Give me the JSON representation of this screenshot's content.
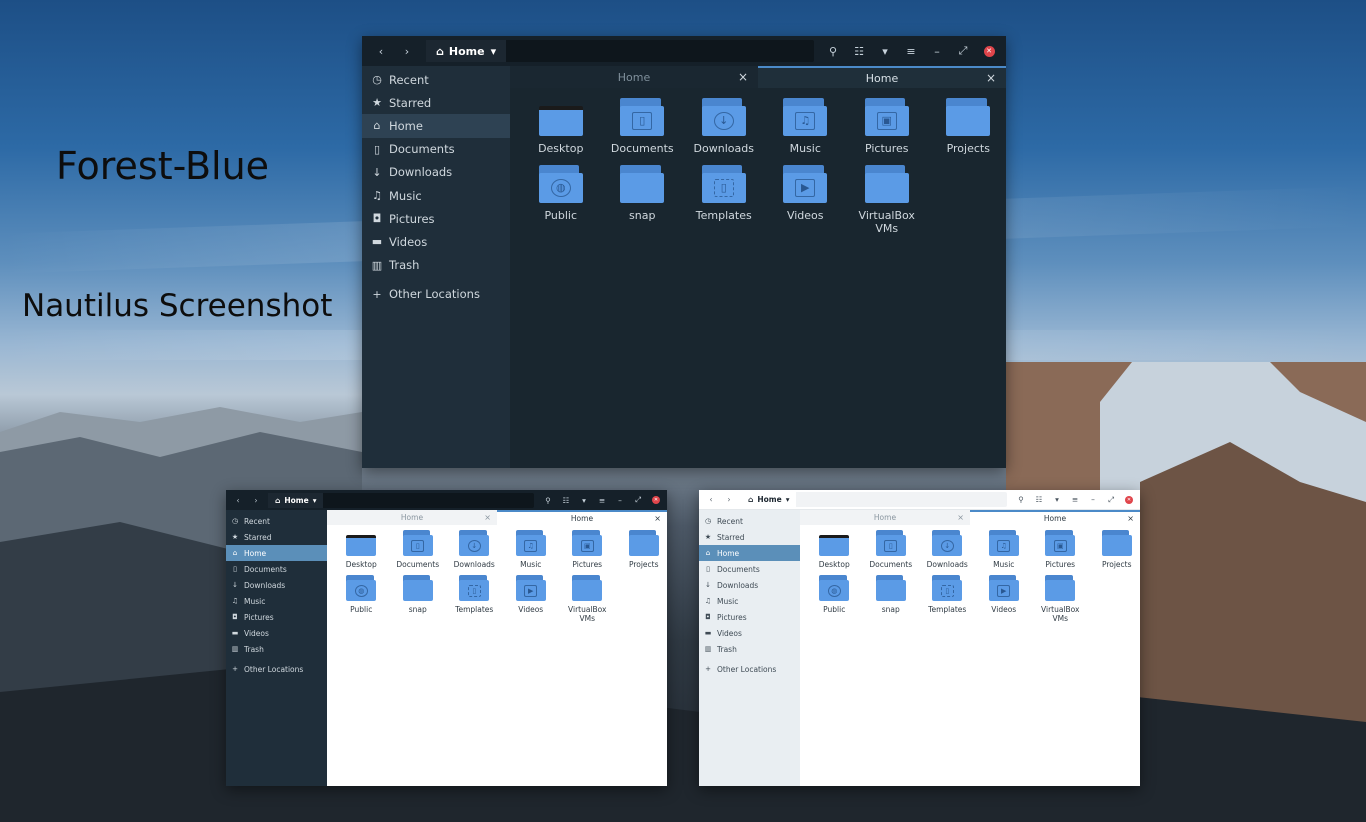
{
  "captions": {
    "title": "Forest-Blue",
    "subtitle": "Nautilus Screenshot"
  },
  "theme_colors": {
    "folder_body": "#5b9be6",
    "folder_tab": "#4a86cf",
    "accent": "#4b8ac8",
    "close_button": "#e0454b",
    "dark_sidebar": "#1f2e3a",
    "dark_header": "#152029"
  },
  "window": {
    "path_label": "Home",
    "tabs": [
      {
        "label": "Home",
        "active": false
      },
      {
        "label": "Home",
        "active": true
      }
    ],
    "sidebar": [
      {
        "label": "Recent",
        "icon": "clock-icon",
        "glyph": "◷"
      },
      {
        "label": "Starred",
        "icon": "star-icon",
        "glyph": "★"
      },
      {
        "label": "Home",
        "icon": "home-icon",
        "glyph": "⌂",
        "selected": true
      },
      {
        "label": "Documents",
        "icon": "document-icon",
        "glyph": "▯"
      },
      {
        "label": "Downloads",
        "icon": "download-icon",
        "glyph": "↓"
      },
      {
        "label": "Music",
        "icon": "music-icon",
        "glyph": "♫"
      },
      {
        "label": "Pictures",
        "icon": "camera-icon",
        "glyph": "◘"
      },
      {
        "label": "Videos",
        "icon": "video-icon",
        "glyph": "▬"
      },
      {
        "label": "Trash",
        "icon": "trash-icon",
        "glyph": "▥"
      },
      {
        "label": "Other Locations",
        "icon": "plus-icon",
        "glyph": "+"
      }
    ],
    "folders": [
      {
        "name": "Desktop",
        "icon": "desktop-folder-icon",
        "glyph": ""
      },
      {
        "name": "Documents",
        "icon": "documents-folder-icon",
        "glyph": "▯"
      },
      {
        "name": "Downloads",
        "icon": "downloads-folder-icon",
        "glyph": "↓"
      },
      {
        "name": "Music",
        "icon": "music-folder-icon",
        "glyph": "♫"
      },
      {
        "name": "Pictures",
        "icon": "pictures-folder-icon",
        "glyph": "▣"
      },
      {
        "name": "Projects",
        "icon": "projects-folder-icon",
        "glyph": ""
      },
      {
        "name": "Public",
        "icon": "public-folder-icon",
        "glyph": "◍"
      },
      {
        "name": "snap",
        "icon": "snap-folder-icon",
        "glyph": ""
      },
      {
        "name": "Templates",
        "icon": "templates-folder-icon",
        "glyph": "▯"
      },
      {
        "name": "Videos",
        "icon": "videos-folder-icon",
        "glyph": "▶"
      },
      {
        "name": "VirtualBox VMs",
        "icon": "virtualbox-folder-icon",
        "glyph": ""
      }
    ],
    "header_icons": {
      "back": "‹",
      "forward": "›",
      "home": "⌂",
      "path_dropdown": "▾",
      "search": "⚲",
      "view": "☷",
      "view_dropdown": "▾",
      "menu": "≡",
      "minimize": "–",
      "maximize": "⤢",
      "close": "✕",
      "tab_close": "×"
    }
  }
}
